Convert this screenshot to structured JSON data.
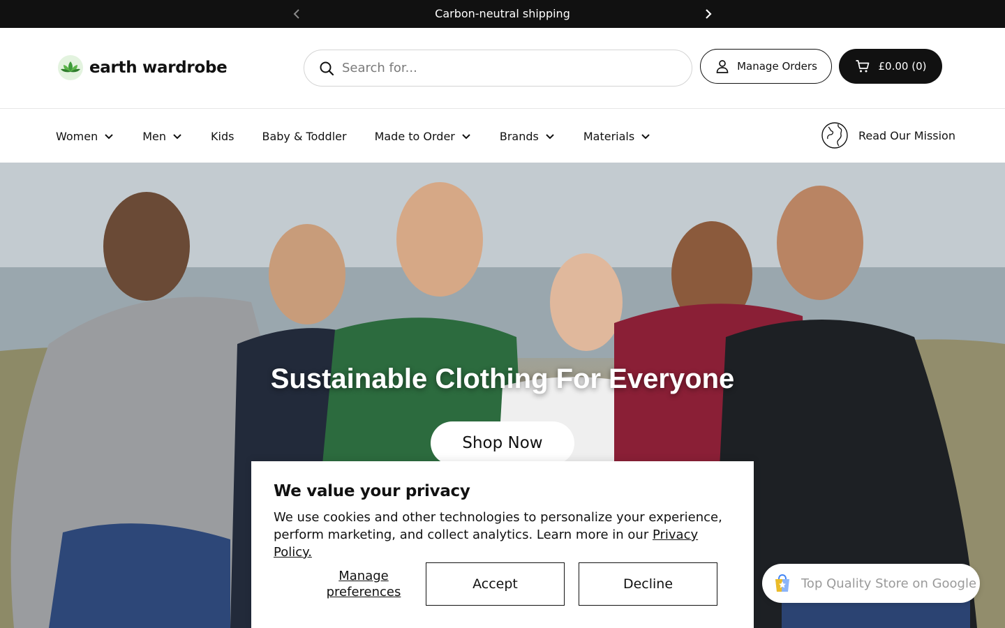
{
  "announcement": {
    "message": "Carbon-neutral shipping"
  },
  "header": {
    "logo_text": "earth wardrobe",
    "search_placeholder": "Search for...",
    "manage_orders_label": "Manage Orders",
    "cart_label": "£0.00 (0)"
  },
  "nav": {
    "items": [
      {
        "label": "Women",
        "has_dropdown": true
      },
      {
        "label": "Men",
        "has_dropdown": true
      },
      {
        "label": "Kids",
        "has_dropdown": false
      },
      {
        "label": "Baby & Toddler",
        "has_dropdown": false
      },
      {
        "label": "Made to Order",
        "has_dropdown": true
      },
      {
        "label": "Brands",
        "has_dropdown": true
      },
      {
        "label": "Materials",
        "has_dropdown": true
      }
    ],
    "mission_label": "Read Our Mission"
  },
  "hero": {
    "title": "Sustainable Clothing For Everyone",
    "cta_label": "Shop Now"
  },
  "cookie": {
    "title": "We value your privacy",
    "body": "We use cookies and other technologies to personalize your experience, perform marketing, and collect analytics. Learn more in our ",
    "policy_link": "Privacy Policy.",
    "manage_label": "Manage preferences",
    "accept_label": "Accept",
    "decline_label": "Decline"
  },
  "google_badge": {
    "label": "Top Quality Store on Google"
  },
  "colors": {
    "dark": "#111111",
    "brand_green": "#4caf50",
    "muted": "#9a9a9a"
  }
}
